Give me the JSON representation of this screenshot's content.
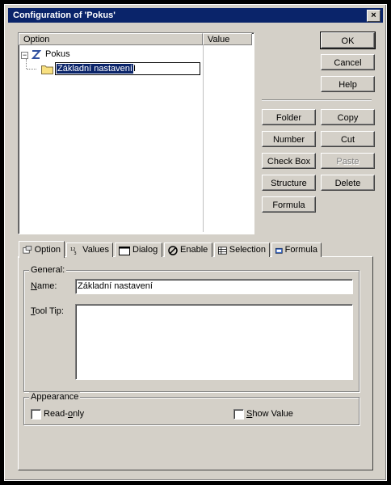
{
  "window": {
    "title": "Configuration of 'Pokus'",
    "close_glyph": "×"
  },
  "tree": {
    "columns": [
      "Option",
      "Value"
    ],
    "root": "Pokus",
    "child_edit_value": "Základní nastavení",
    "expander": "−"
  },
  "buttons": {
    "ok": "OK",
    "cancel": "Cancel",
    "help": "Help",
    "folder": "Folder",
    "copy": "Copy",
    "number": "Number",
    "cut": "Cut",
    "checkbox": "Check Box",
    "paste": "Paste",
    "structure": "Structure",
    "delete": "Delete",
    "formula": "Formula"
  },
  "tabs": [
    "Option",
    "Values",
    "Dialog",
    "Enable",
    "Selection",
    "Formula"
  ],
  "option_panel": {
    "general_legend": "General:",
    "name_label": "Name:",
    "name_value": "Základní nastavení",
    "tooltip_label": "Tool Tip:",
    "tooltip_value": "",
    "appearance_legend": "Appearance",
    "readonly_label": "Read-only",
    "showvalue_label": "Show Value"
  }
}
